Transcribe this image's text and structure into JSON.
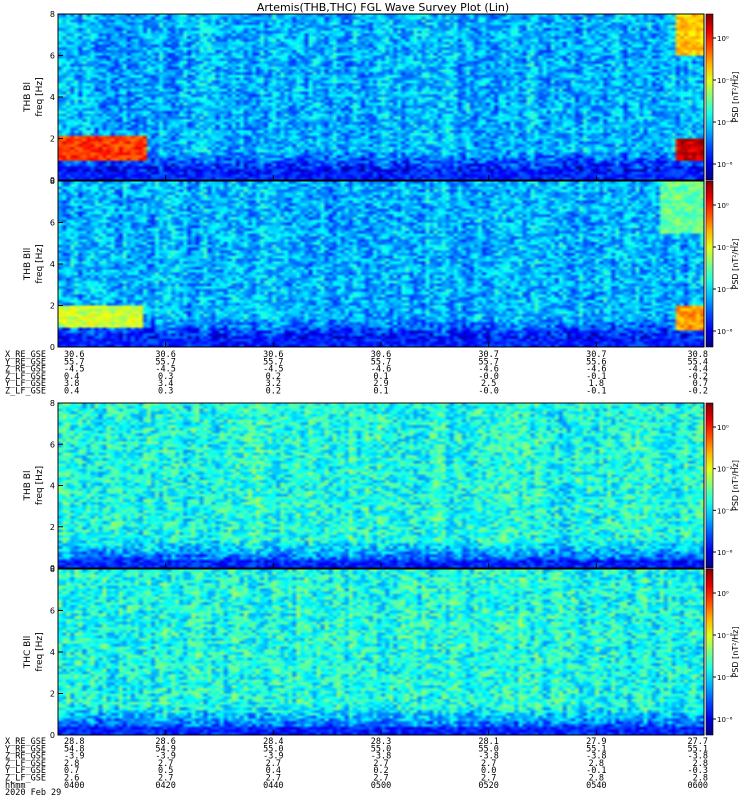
{
  "title": "Artemis(THB,THC) FGL Wave Survey Plot (Lin)",
  "chart_data": [
    {
      "type": "heatmap",
      "probe": "THB",
      "quantity": "Bl",
      "ylabel_top": "THB Bl",
      "ylabel_bottom": "freq [Hz]",
      "ylim": [
        0,
        8
      ],
      "yticks": [
        "0",
        "2",
        "4",
        "6",
        "8"
      ],
      "colorbar_label": "PSD [nT²/Hz]",
      "colorbar_ticks": [
        "10⁰",
        "10⁻²",
        "10⁻⁴",
        "10⁻⁶"
      ],
      "features": [
        {
          "x_start": 0.0,
          "x_end": 0.135,
          "f_lo": 1.0,
          "f_hi": 2.1,
          "level": 0.9
        },
        {
          "x_start": 0.955,
          "x_end": 1.0,
          "f_lo": 1.0,
          "f_hi": 2.0,
          "level": 1.0
        },
        {
          "x_start": 0.955,
          "x_end": 1.0,
          "f_lo": 6.0,
          "f_hi": 8.0,
          "level": 0.75
        }
      ]
    },
    {
      "type": "heatmap",
      "probe": "THB",
      "quantity": "Bll",
      "ylabel_top": "THB Bll",
      "ylabel_bottom": "freq [Hz]",
      "ylim": [
        0,
        8
      ],
      "yticks": [
        "0",
        "2",
        "4",
        "6",
        "8"
      ],
      "colorbar_label": "PSD [nT²/Hz]",
      "colorbar_ticks": [
        "10⁰",
        "10⁻²",
        "10⁻⁴",
        "10⁻⁶"
      ],
      "features": [
        {
          "x_start": 0.0,
          "x_end": 0.13,
          "f_lo": 1.0,
          "f_hi": 2.0,
          "level": 0.65
        },
        {
          "x_start": 0.93,
          "x_end": 1.0,
          "f_lo": 5.5,
          "f_hi": 8.0,
          "level": 0.55
        },
        {
          "x_start": 0.955,
          "x_end": 1.0,
          "f_lo": 0.8,
          "f_hi": 2.0,
          "level": 0.8
        }
      ]
    },
    {
      "type": "heatmap",
      "probe": "THB",
      "quantity": "Bl",
      "ylabel_top": "THB Bl",
      "ylabel_bottom": "freq [Hz]",
      "ylim": [
        0,
        8
      ],
      "yticks": [
        "0",
        "2",
        "4",
        "6",
        "8"
      ],
      "colorbar_label": "PSD [nT²/Hz]",
      "colorbar_ticks": [
        "10⁰",
        "10⁻²",
        "10⁻⁴",
        "10⁻⁶"
      ],
      "features": []
    },
    {
      "type": "heatmap",
      "probe": "THC",
      "quantity": "Bll",
      "ylabel_top": "THC Bll",
      "ylabel_bottom": "freq [Hz]",
      "ylim": [
        0,
        8
      ],
      "yticks": [
        "0",
        "2",
        "4",
        "6",
        "8"
      ],
      "colorbar_label": "PSD [nT²/Hz]",
      "colorbar_ticks": [
        "10⁰",
        "10⁻²",
        "10⁻⁴",
        "10⁻⁶"
      ],
      "features": []
    }
  ],
  "ephem_top": {
    "labels": [
      "X_RE_GSE",
      "Y_RE_GSE",
      "Z_RE_GSE",
      "Z_LF_GSE",
      "Y_LF_GSE",
      "Z_LF_GSE"
    ],
    "columns": [
      [
        "30.6",
        "55.7",
        "-4.5",
        "0.4",
        "3.8",
        "0.4"
      ],
      [
        "30.6",
        "55.7",
        "-4.5",
        "0.3",
        "3.4",
        "0.3"
      ],
      [
        "30.6",
        "55.7",
        "-4.5",
        "0.2",
        "3.2",
        "0.2"
      ],
      [
        "30.6",
        "55.7",
        "-4.6",
        "0.1",
        "2.9",
        "0.1"
      ],
      [
        "30.7",
        "55.7",
        "-4.6",
        "-0.0",
        "2.5",
        "-0.0"
      ],
      [
        "30.7",
        "55.6",
        "-4.6",
        "-0.1",
        "1.8",
        "-0.1"
      ],
      [
        "30.8",
        "55.4",
        "-4.4",
        "-0.2",
        "0.7",
        "-0.2"
      ]
    ]
  },
  "ephem_bottom": {
    "labels": [
      "X_RE_GSE",
      "Y_RE_GSE",
      "Z_RE_GSE",
      "Z_LF_GSE",
      "Y_LF_GSE",
      "Z_LF_GSE",
      "hhmm",
      "2020 Feb 29"
    ],
    "columns": [
      [
        "28.8",
        "54.8",
        "-3.9",
        "2.8",
        "0.7",
        "2.6",
        "0400"
      ],
      [
        "28.6",
        "54.9",
        "-3.9",
        "2.7",
        "0.5",
        "2.7",
        "0420"
      ],
      [
        "28.4",
        "55.0",
        "-3.9",
        "2.7",
        "0.4",
        "2.7",
        "0440"
      ],
      [
        "28.3",
        "55.0",
        "-3.8",
        "2.7",
        "0.2",
        "2.7",
        "0500"
      ],
      [
        "28.1",
        "55.0",
        "-3.8",
        "2.7",
        "0.0",
        "2.7",
        "0520"
      ],
      [
        "27.9",
        "55.1",
        "-3.8",
        "2.8",
        "-0.1",
        "2.8",
        "0540"
      ],
      [
        "27.7",
        "55.1",
        "-3.8",
        "2.8",
        "-0.3",
        "2.8",
        "0600"
      ]
    ]
  }
}
